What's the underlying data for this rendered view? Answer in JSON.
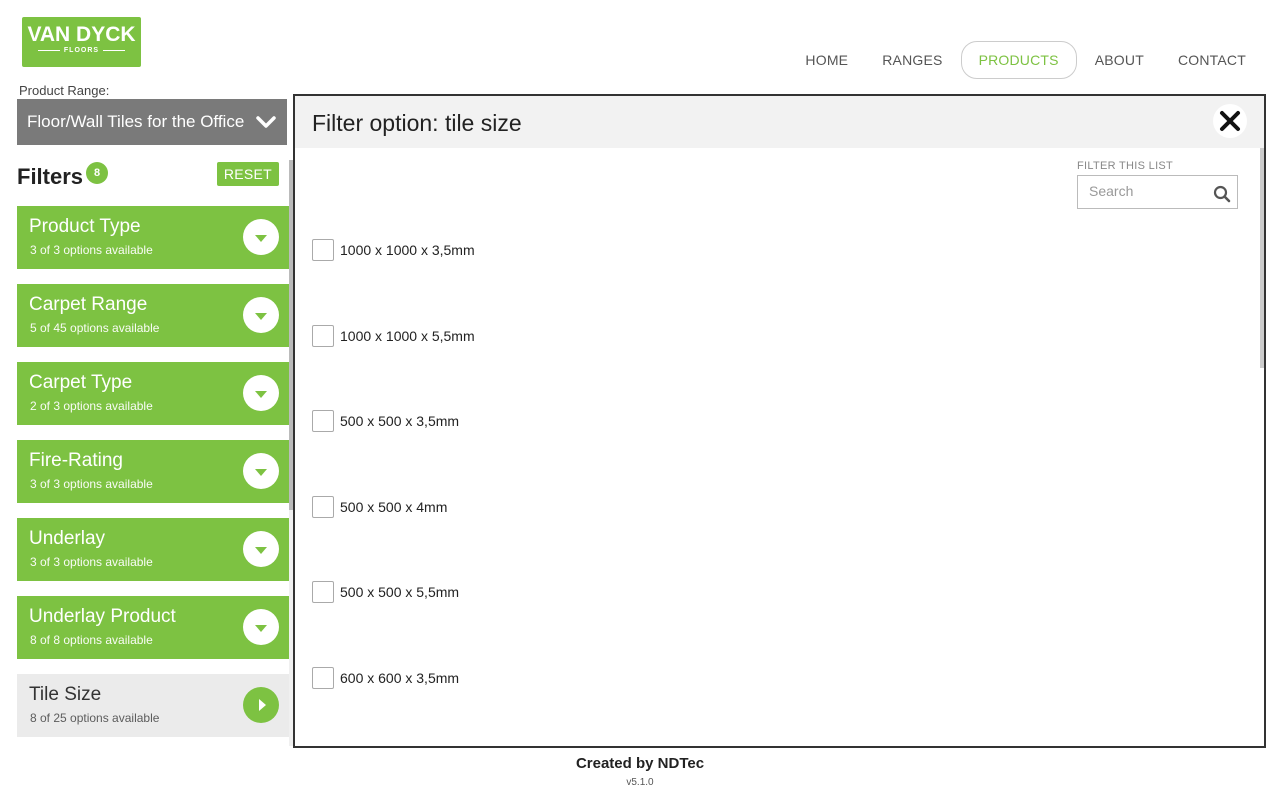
{
  "logo": {
    "brand": "VAN DYCK",
    "sub": "FLOORS"
  },
  "nav": [
    {
      "label": "HOME",
      "active": false
    },
    {
      "label": "RANGES",
      "active": false
    },
    {
      "label": "PRODUCTS",
      "active": true
    },
    {
      "label": "ABOUT",
      "active": false
    },
    {
      "label": "CONTACT",
      "active": false
    }
  ],
  "sidebar": {
    "range_label": "Product Range:",
    "range_value": "Floor/Wall Tiles for the Office",
    "filters_title": "Filters",
    "filters_count": "8",
    "reset_label": "RESET",
    "filters": [
      {
        "name": "Product Type",
        "sub": "3 of 3 options available",
        "active": true
      },
      {
        "name": "Carpet Range",
        "sub": "5 of 45 options available",
        "active": true
      },
      {
        "name": "Carpet Type",
        "sub": "2 of 3 options available",
        "active": true
      },
      {
        "name": "Fire-Rating",
        "sub": "3 of 3 options available",
        "active": true
      },
      {
        "name": "Underlay",
        "sub": "3 of 3 options available",
        "active": true
      },
      {
        "name": "Underlay Product",
        "sub": "8 of 8 options available",
        "active": true
      },
      {
        "name": "Tile Size",
        "sub": "8 of 25 options available",
        "active": false
      }
    ]
  },
  "modal": {
    "title": "Filter option: tile size",
    "filter_list_label": "FILTER THIS LIST",
    "search_placeholder": "Search",
    "options": [
      {
        "label": "1000 x 1000 x 3,5mm",
        "checked": false
      },
      {
        "label": "1000 x 1000 x 5,5mm",
        "checked": false
      },
      {
        "label": "500 x 500 x 3,5mm",
        "checked": false
      },
      {
        "label": "500 x 500 x 4mm",
        "checked": false
      },
      {
        "label": "500 x 500 x 5,5mm",
        "checked": false
      },
      {
        "label": "600 x 600 x 3,5mm",
        "checked": false
      }
    ]
  },
  "footer": {
    "created": "Created by NDTec",
    "version": "v5.1.0"
  },
  "colors": {
    "accent": "#7dc242",
    "range_bg": "#7a7a7a"
  }
}
